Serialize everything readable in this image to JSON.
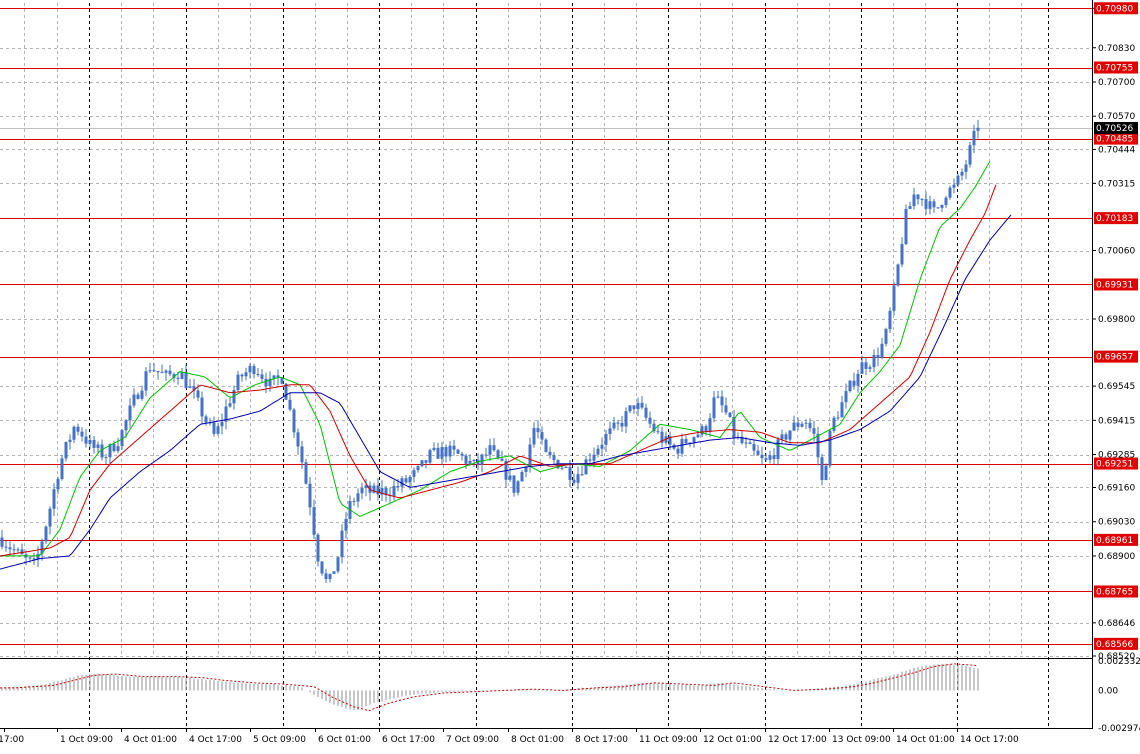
{
  "chart": {
    "price_labels": [
      "0.70980",
      "0.70830",
      "0.70700",
      "0.70570",
      "0.70444",
      "0.70315",
      "0.70060",
      "0.69800",
      "0.69545",
      "0.69415",
      "0.69285",
      "0.69160",
      "0.69030",
      "0.68900",
      "0.68646",
      "0.68520"
    ],
    "price_current": "0.70526",
    "indicator_labels": [
      "0.002332",
      "0.00",
      "-0.002974"
    ],
    "time_labels": [
      "30 Sep 17:00",
      "1 Oct 09:00",
      "4 Oct 01:00",
      "4 Oct 17:00",
      "5 Oct 09:00",
      "6 Oct 01:00",
      "6 Oct 17:00",
      "7 Oct 09:00",
      "8 Oct 01:00",
      "8 Oct 17:00",
      "11 Oct 09:00",
      "12 Oct 01:00",
      "12 Oct 17:00",
      "13 Oct 09:00",
      "14 Oct 01:00",
      "14 Oct 17:00"
    ],
    "levels": [
      "0.70980",
      "0.70755",
      "0.70485",
      "0.70183",
      "0.69931",
      "0.69657",
      "0.69251",
      "0.68961",
      "0.68765",
      "0.68566"
    ],
    "colors": {
      "background": "#ffffff",
      "candle": "#4472c4",
      "level_line": "#e00000",
      "level_label_bg": "#e00000",
      "current_price_bg": "#000000",
      "ma_fast": "#00c000",
      "ma_mid": "#d00000",
      "ma_slow": "#0000b0",
      "histogram": "#b0b0b0",
      "signal": "#d00000",
      "grid": "#b4b4b4",
      "separator": "#000000"
    }
  },
  "chart_data": {
    "type": "candlestick",
    "y_range": [
      0.6852,
      0.71
    ],
    "x_range": [
      0,
      1000
    ],
    "levels": [
      0.7098,
      0.70755,
      0.70485,
      0.70183,
      0.69931,
      0.69657,
      0.69251,
      0.68961,
      0.68765,
      0.68566
    ],
    "current_price": 0.70526,
    "price_anchors": [
      [
        0,
        0.6897
      ],
      [
        20,
        0.689
      ],
      [
        35,
        0.6886
      ],
      [
        48,
        0.6905
      ],
      [
        60,
        0.6925
      ],
      [
        75,
        0.694
      ],
      [
        90,
        0.6932
      ],
      [
        105,
        0.6928
      ],
      [
        120,
        0.6935
      ],
      [
        135,
        0.695
      ],
      [
        150,
        0.6962
      ],
      [
        165,
        0.6958
      ],
      [
        180,
        0.696
      ],
      [
        195,
        0.695
      ],
      [
        205,
        0.6942
      ],
      [
        215,
        0.6935
      ],
      [
        228,
        0.6948
      ],
      [
        240,
        0.6958
      ],
      [
        255,
        0.6962
      ],
      [
        270,
        0.6955
      ],
      [
        282,
        0.6958
      ],
      [
        290,
        0.6945
      ],
      [
        300,
        0.693
      ],
      [
        310,
        0.691
      ],
      [
        318,
        0.689
      ],
      [
        328,
        0.6878
      ],
      [
        338,
        0.689
      ],
      [
        348,
        0.6908
      ],
      [
        360,
        0.6915
      ],
      [
        375,
        0.6914
      ],
      [
        390,
        0.6915
      ],
      [
        405,
        0.6918
      ],
      [
        418,
        0.6922
      ],
      [
        430,
        0.6928
      ],
      [
        445,
        0.693
      ],
      [
        460,
        0.6928
      ],
      [
        475,
        0.6924
      ],
      [
        490,
        0.693
      ],
      [
        505,
        0.6922
      ],
      [
        515,
        0.6915
      ],
      [
        525,
        0.6925
      ],
      [
        535,
        0.694
      ],
      [
        545,
        0.6928
      ],
      [
        560,
        0.6925
      ],
      [
        575,
        0.692
      ],
      [
        590,
        0.6928
      ],
      [
        605,
        0.6935
      ],
      [
        620,
        0.694
      ],
      [
        635,
        0.6948
      ],
      [
        650,
        0.694
      ],
      [
        660,
        0.6935
      ],
      [
        675,
        0.693
      ],
      [
        690,
        0.6935
      ],
      [
        705,
        0.6938
      ],
      [
        715,
        0.695
      ],
      [
        725,
        0.6945
      ],
      [
        735,
        0.6935
      ],
      [
        750,
        0.693
      ],
      [
        765,
        0.6925
      ],
      [
        775,
        0.693
      ],
      [
        790,
        0.6938
      ],
      [
        805,
        0.6942
      ],
      [
        815,
        0.6935
      ],
      [
        822,
        0.6918
      ],
      [
        832,
        0.694
      ],
      [
        845,
        0.695
      ],
      [
        860,
        0.6962
      ],
      [
        875,
        0.6965
      ],
      [
        885,
        0.6972
      ],
      [
        895,
        0.6992
      ],
      [
        905,
        0.7018
      ],
      [
        915,
        0.7028
      ],
      [
        925,
        0.7025
      ],
      [
        935,
        0.702
      ],
      [
        945,
        0.7028
      ],
      [
        955,
        0.703
      ],
      [
        965,
        0.7038
      ],
      [
        975,
        0.705
      ],
      [
        980,
        0.7052
      ]
    ],
    "ma_fast_anchors": [
      [
        0,
        0.689
      ],
      [
        40,
        0.689
      ],
      [
        60,
        0.69
      ],
      [
        80,
        0.692
      ],
      [
        100,
        0.693
      ],
      [
        125,
        0.6935
      ],
      [
        150,
        0.695
      ],
      [
        180,
        0.696
      ],
      [
        205,
        0.6958
      ],
      [
        230,
        0.695
      ],
      [
        255,
        0.6955
      ],
      [
        280,
        0.6958
      ],
      [
        300,
        0.6955
      ],
      [
        320,
        0.694
      ],
      [
        340,
        0.691
      ],
      [
        360,
        0.6905
      ],
      [
        390,
        0.691
      ],
      [
        420,
        0.6915
      ],
      [
        450,
        0.6922
      ],
      [
        480,
        0.6926
      ],
      [
        510,
        0.6928
      ],
      [
        540,
        0.6922
      ],
      [
        570,
        0.6925
      ],
      [
        600,
        0.6924
      ],
      [
        630,
        0.693
      ],
      [
        660,
        0.694
      ],
      [
        690,
        0.6938
      ],
      [
        720,
        0.6935
      ],
      [
        740,
        0.6945
      ],
      [
        760,
        0.6935
      ],
      [
        790,
        0.693
      ],
      [
        815,
        0.6935
      ],
      [
        840,
        0.694
      ],
      [
        860,
        0.6952
      ],
      [
        880,
        0.696
      ],
      [
        900,
        0.697
      ],
      [
        920,
        0.6995
      ],
      [
        940,
        0.7015
      ],
      [
        960,
        0.7022
      ],
      [
        975,
        0.703
      ],
      [
        990,
        0.704
      ]
    ],
    "ma_mid_anchors": [
      [
        0,
        0.689
      ],
      [
        50,
        0.6893
      ],
      [
        70,
        0.6897
      ],
      [
        90,
        0.6915
      ],
      [
        110,
        0.6925
      ],
      [
        140,
        0.6935
      ],
      [
        170,
        0.6945
      ],
      [
        200,
        0.6955
      ],
      [
        230,
        0.6952
      ],
      [
        260,
        0.6953
      ],
      [
        290,
        0.6955
      ],
      [
        310,
        0.6955
      ],
      [
        330,
        0.6945
      ],
      [
        350,
        0.6928
      ],
      [
        370,
        0.6915
      ],
      [
        400,
        0.6912
      ],
      [
        430,
        0.6915
      ],
      [
        460,
        0.6918
      ],
      [
        490,
        0.6922
      ],
      [
        520,
        0.6928
      ],
      [
        550,
        0.6924
      ],
      [
        580,
        0.6925
      ],
      [
        610,
        0.6925
      ],
      [
        640,
        0.693
      ],
      [
        670,
        0.6935
      ],
      [
        700,
        0.6937
      ],
      [
        730,
        0.6938
      ],
      [
        760,
        0.6937
      ],
      [
        790,
        0.6933
      ],
      [
        820,
        0.6933
      ],
      [
        850,
        0.6938
      ],
      [
        880,
        0.6948
      ],
      [
        910,
        0.6958
      ],
      [
        930,
        0.6975
      ],
      [
        950,
        0.6995
      ],
      [
        970,
        0.701
      ],
      [
        985,
        0.702
      ],
      [
        998,
        0.7033
      ]
    ],
    "ma_slow_anchors": [
      [
        0,
        0.6885
      ],
      [
        40,
        0.6889
      ],
      [
        70,
        0.689
      ],
      [
        90,
        0.69
      ],
      [
        110,
        0.6912
      ],
      [
        140,
        0.6922
      ],
      [
        170,
        0.693
      ],
      [
        200,
        0.694
      ],
      [
        230,
        0.6942
      ],
      [
        260,
        0.6945
      ],
      [
        290,
        0.6952
      ],
      [
        320,
        0.6952
      ],
      [
        340,
        0.6948
      ],
      [
        360,
        0.6935
      ],
      [
        380,
        0.6922
      ],
      [
        410,
        0.6916
      ],
      [
        440,
        0.6918
      ],
      [
        470,
        0.692
      ],
      [
        500,
        0.6922
      ],
      [
        530,
        0.6924
      ],
      [
        560,
        0.6925
      ],
      [
        590,
        0.6925
      ],
      [
        620,
        0.6928
      ],
      [
        650,
        0.693
      ],
      [
        680,
        0.6932
      ],
      [
        710,
        0.6934
      ],
      [
        740,
        0.6935
      ],
      [
        770,
        0.6933
      ],
      [
        800,
        0.6932
      ],
      [
        830,
        0.6934
      ],
      [
        860,
        0.6938
      ],
      [
        890,
        0.6945
      ],
      [
        920,
        0.6958
      ],
      [
        945,
        0.6978
      ],
      [
        965,
        0.6995
      ],
      [
        990,
        0.701
      ],
      [
        1012,
        0.702
      ]
    ],
    "indicator_range": [
      -0.002974,
      0.002332
    ],
    "indicator_anchors": [
      [
        0,
        0.0002
      ],
      [
        40,
        0.0004
      ],
      [
        60,
        0.0008
      ],
      [
        80,
        0.0012
      ],
      [
        100,
        0.0013
      ],
      [
        130,
        0.0011
      ],
      [
        160,
        0.0011
      ],
      [
        190,
        0.001
      ],
      [
        210,
        0.0008
      ],
      [
        240,
        0.0006
      ],
      [
        270,
        0.0005
      ],
      [
        300,
        0.0003
      ],
      [
        320,
        -0.0006
      ],
      [
        340,
        -0.0013
      ],
      [
        355,
        -0.0016
      ],
      [
        375,
        -0.001
      ],
      [
        400,
        -0.0005
      ],
      [
        430,
        -0.0002
      ],
      [
        460,
        -0.0001
      ],
      [
        490,
        0.0
      ],
      [
        520,
        0.0001
      ],
      [
        550,
        0.0
      ],
      [
        580,
        0.0002
      ],
      [
        610,
        0.0003
      ],
      [
        640,
        0.0006
      ],
      [
        670,
        0.0005
      ],
      [
        700,
        0.0004
      ],
      [
        720,
        0.0006
      ],
      [
        750,
        0.0003
      ],
      [
        780,
        0.0
      ],
      [
        810,
        0.0001
      ],
      [
        840,
        0.0003
      ],
      [
        860,
        0.0006
      ],
      [
        880,
        0.001
      ],
      [
        900,
        0.0014
      ],
      [
        920,
        0.0019
      ],
      [
        940,
        0.0021
      ],
      [
        960,
        0.002
      ],
      [
        980,
        0.0017
      ]
    ]
  }
}
